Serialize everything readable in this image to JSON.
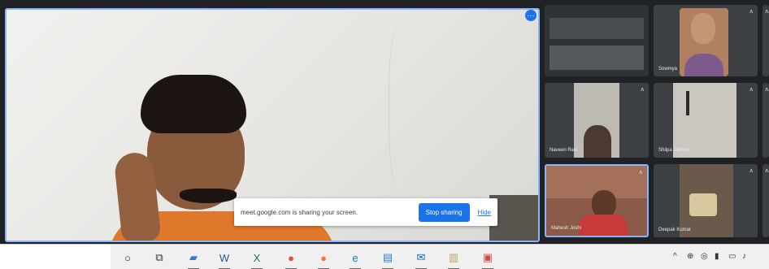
{
  "main_stage": {
    "sharing_banner": {
      "message": "meet.google.com is sharing your screen.",
      "stop_label": "Stop sharing",
      "hide_label": "Hide"
    },
    "pin_badge_glyph": "⋯"
  },
  "participants": [
    {
      "name": "",
      "mic_glyph": ""
    },
    {
      "name": "Sowmya",
      "mic_glyph": "ʌ"
    },
    {
      "name": "",
      "mic_glyph": "ʌ"
    },
    {
      "name": "Naveen Ravi",
      "mic_glyph": "ʌ"
    },
    {
      "name": "Shilpa Jadhav",
      "mic_glyph": "ʌ"
    },
    {
      "name": "",
      "mic_glyph": "ʌ"
    },
    {
      "name": "Mahesh Joshi",
      "mic_glyph": "ʌ"
    },
    {
      "name": "Deepak Kumar",
      "mic_glyph": "ʌ"
    },
    {
      "name": "",
      "mic_glyph": "ʌ"
    }
  ],
  "taskbar": {
    "icons": [
      {
        "name": "search-circle-icon",
        "glyph": "○",
        "color": "#222222"
      },
      {
        "name": "task-view-icon",
        "glyph": "⧉",
        "color": "#333333"
      },
      {
        "name": "file-explorer-icon",
        "glyph": "▰",
        "color": "#3a78c5"
      },
      {
        "name": "word-icon",
        "glyph": "W",
        "color": "#2b579a"
      },
      {
        "name": "excel-icon",
        "glyph": "X",
        "color": "#217346"
      },
      {
        "name": "chrome-icon",
        "glyph": "●",
        "color": "#dd4b39"
      },
      {
        "name": "firefox-icon",
        "glyph": "●",
        "color": "#ff7139"
      },
      {
        "name": "edge-icon",
        "glyph": "e",
        "color": "#0a7bc3"
      },
      {
        "name": "store-icon",
        "glyph": "▤",
        "color": "#2f7ed8"
      },
      {
        "name": "mail-icon",
        "glyph": "✉",
        "color": "#0f6cbd"
      },
      {
        "name": "notepad-icon",
        "glyph": "▥",
        "color": "#c0a060"
      },
      {
        "name": "photos-icon",
        "glyph": "▣",
        "color": "#d24848"
      }
    ],
    "tray": [
      "^",
      "⊕",
      "◎",
      "▮",
      "▭",
      "♪"
    ]
  }
}
